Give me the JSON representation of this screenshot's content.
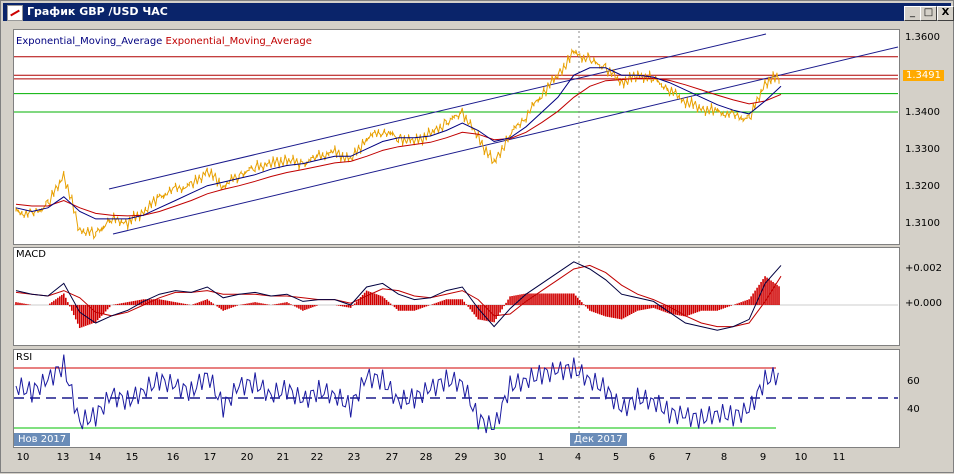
{
  "window": {
    "title": "График GBP /USD ЧАС",
    "controls": {
      "minimize": "_",
      "maximize": "□",
      "close": "X"
    }
  },
  "main_chart": {
    "legend": [
      {
        "label": "Exponential_Moving_Average",
        "color": "#000080"
      },
      {
        "label": "Exponential_Moving_Average",
        "color": "#c00000"
      }
    ],
    "y_ticks": [
      "1.3600",
      "1.3400",
      "1.3300",
      "1.3200",
      "1.3100"
    ],
    "current_price": "1.3491",
    "current_price_color": "#ffaa00",
    "price_color": "#e8a000"
  },
  "macd_panel": {
    "title": "MACD",
    "y_ticks": [
      "+0.002",
      "+0.000"
    ]
  },
  "rsi_panel": {
    "title": "RSI",
    "y_ticks": [
      "60",
      "40"
    ]
  },
  "x_axis": {
    "ticks": [
      "10",
      "13",
      "14",
      "15",
      "16",
      "17",
      "20",
      "21",
      "22",
      "23",
      "27",
      "28",
      "29",
      "30",
      "1",
      "4",
      "5",
      "6",
      "7",
      "8",
      "9",
      "10",
      "11"
    ],
    "month_labels": [
      "Нов 2017",
      "Дек 2017"
    ]
  },
  "chart_data": {
    "type": "line",
    "series": [
      {
        "name": "GBP/USD",
        "values": [
          1.313,
          1.312,
          1.315,
          1.323,
          1.308,
          1.307,
          1.311,
          1.31,
          1.313,
          1.317,
          1.319,
          1.32,
          1.324,
          1.32,
          1.323,
          1.325,
          1.326,
          1.327,
          1.326,
          1.328,
          1.329,
          1.327,
          1.333,
          1.335,
          1.333,
          1.332,
          1.334,
          1.337,
          1.34,
          1.333,
          1.326,
          1.334,
          1.339,
          1.345,
          1.35,
          1.356,
          1.354,
          1.352,
          1.348,
          1.35,
          1.349,
          1.346,
          1.343,
          1.341,
          1.34,
          1.339,
          1.338,
          1.348,
          1.35
        ]
      },
      {
        "name": "Exponential_Moving_Average",
        "values": [
          1.314,
          1.313,
          1.314,
          1.317,
          1.313,
          1.311,
          1.311,
          1.311,
          1.312,
          1.314,
          1.316,
          1.318,
          1.32,
          1.321,
          1.322,
          1.323,
          1.3245,
          1.3255,
          1.326,
          1.327,
          1.328,
          1.328,
          1.33,
          1.332,
          1.333,
          1.333,
          1.3335,
          1.335,
          1.337,
          1.335,
          1.332,
          1.333,
          1.336,
          1.34,
          1.344,
          1.35,
          1.352,
          1.352,
          1.35,
          1.35,
          1.3495,
          1.348,
          1.346,
          1.344,
          1.342,
          1.3405,
          1.3395,
          1.343,
          1.347
        ]
      },
      {
        "name": "Exponential_Moving_Average",
        "values": [
          1.315,
          1.3145,
          1.3145,
          1.316,
          1.314,
          1.3125,
          1.312,
          1.3118,
          1.312,
          1.313,
          1.3145,
          1.316,
          1.3178,
          1.319,
          1.32,
          1.3212,
          1.3225,
          1.3236,
          1.3244,
          1.3253,
          1.3262,
          1.3266,
          1.328,
          1.3296,
          1.3306,
          1.3312,
          1.3318,
          1.333,
          1.3345,
          1.334,
          1.3325,
          1.3328,
          1.3345,
          1.3372,
          1.3402,
          1.344,
          1.347,
          1.3485,
          1.3488,
          1.3492,
          1.3492,
          1.3486,
          1.3474,
          1.346,
          1.3446,
          1.3433,
          1.3422,
          1.343,
          1.3448
        ]
      }
    ],
    "ylim": [
      1.305,
      1.362
    ],
    "horizontal_levels": {
      "red": [
        1.355,
        1.35,
        1.349
      ],
      "green": [
        1.345,
        1.34
      ]
    },
    "macd": {
      "line": [
        0.0008,
        0.0006,
        0.0005,
        0.0012,
        -0.0004,
        -0.001,
        -0.0006,
        -0.0003,
        0.0002,
        0.0006,
        0.0008,
        0.0007,
        0.001,
        0.0004,
        0.0006,
        0.0007,
        0.0005,
        0.0006,
        0.0002,
        0.0003,
        0.0003,
        0.0,
        0.001,
        0.0012,
        0.0006,
        0.0003,
        0.0004,
        0.0008,
        0.001,
        -0.0002,
        -0.0012,
        -0.0002,
        0.0006,
        0.0012,
        0.0018,
        0.0024,
        0.002,
        0.0014,
        0.0006,
        0.0004,
        0.0002,
        -0.0004,
        -0.001,
        -0.0012,
        -0.0014,
        -0.0012,
        -0.0008,
        0.0012,
        0.0022
      ],
      "signal": [
        0.0007,
        0.0006,
        0.0005,
        0.0008,
        0.0004,
        -0.0004,
        -0.0006,
        -0.0004,
        0.0,
        0.0004,
        0.0007,
        0.0007,
        0.0008,
        0.0006,
        0.0006,
        0.0006,
        0.0005,
        0.0005,
        0.0004,
        0.0003,
        0.0003,
        0.0001,
        0.0005,
        0.0009,
        0.0008,
        0.0005,
        0.0004,
        0.0006,
        0.0008,
        0.0003,
        -0.0006,
        -0.0005,
        0.0002,
        0.0008,
        0.0014,
        0.002,
        0.0022,
        0.0018,
        0.0011,
        0.0006,
        0.0003,
        -0.0001,
        -0.0006,
        -0.001,
        -0.0012,
        -0.0012,
        -0.001,
        0.0002,
        0.0016
      ],
      "ylim": [
        -0.002,
        0.003
      ]
    },
    "rsi": {
      "values": [
        58,
        54,
        62,
        72,
        34,
        38,
        52,
        48,
        55,
        62,
        58,
        54,
        66,
        44,
        58,
        60,
        52,
        56,
        48,
        55,
        52,
        44,
        64,
        62,
        48,
        50,
        56,
        62,
        60,
        36,
        30,
        58,
        62,
        66,
        68,
        70,
        62,
        56,
        42,
        50,
        48,
        40,
        38,
        36,
        40,
        38,
        42,
        62,
        66
      ],
      "levels": [
        70,
        50,
        30
      ],
      "ylim": [
        20,
        80
      ]
    }
  }
}
